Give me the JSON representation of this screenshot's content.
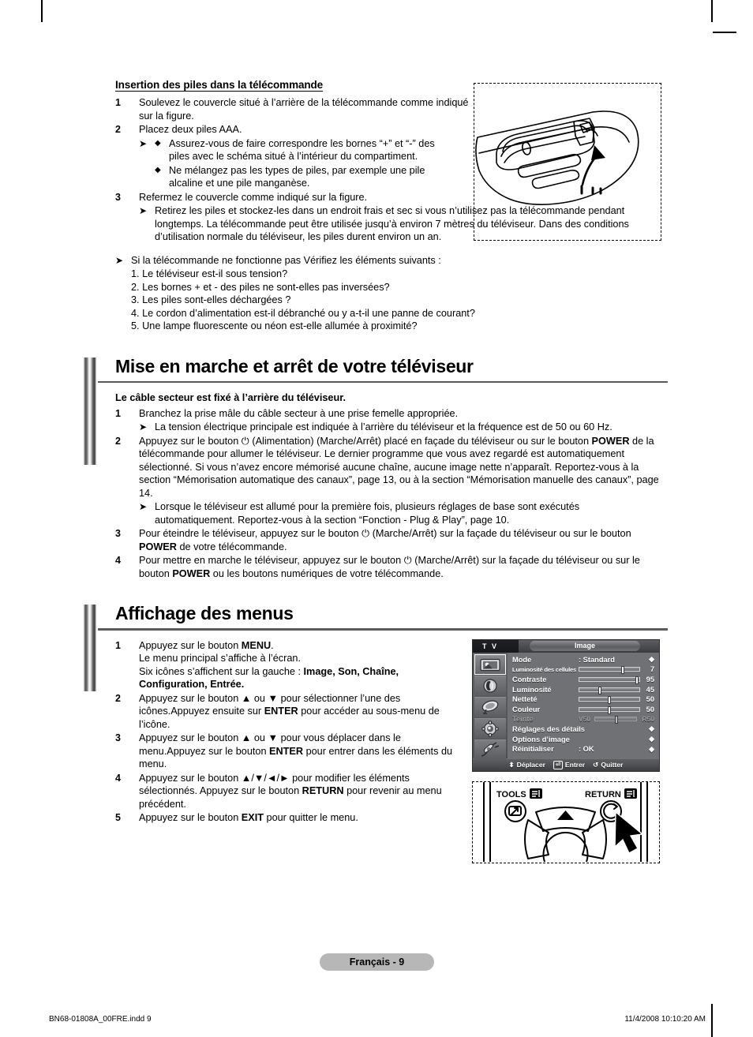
{
  "document": {
    "page_badge": "Français - 9",
    "footer_left": "BN68-01808A_00FRE.indd   9",
    "footer_right": "11/4/2008   10:10:20 AM"
  },
  "battery_section": {
    "heading": "Insertion des piles dans la télécommande",
    "steps": [
      {
        "num": "1",
        "text": "Soulevez le couvercle situé à l’arrière de la télécommande comme indiqué sur la figure."
      },
      {
        "num": "2",
        "text": "Placez deux piles AAA."
      },
      {
        "num": "3",
        "text": "Refermez le couvercle comme indiqué sur la figure."
      }
    ],
    "bullets": [
      "Assurez-vous de faire correspondre les bornes “+” et “-” des piles avec le schéma situé à l’intérieur du compartiment.",
      "Ne mélangez pas les types de piles, par exemple une pile alcaline et une pile manganèse."
    ],
    "note_step3": "Retirez les piles et stockez-les dans un endroit frais et sec si vous n’utilisez pas la télécommande pendant longtemps. La télécommande peut être utilisée jusqu’à environ 7 mètres du téléviseur. Dans des conditions d’utilisation normale du téléviseur, les piles durent environ un an.",
    "troubleshoot_intro": "Si la télécommande ne fonctionne pas Vérifiez les éléments suivants :",
    "troubleshoot": [
      "1. Le téléviseur est-il sous tension?",
      "2. Les bornes + et - des piles ne sont-elles pas inversées?",
      "3. Les piles sont-elles déchargées ?",
      "4. Le cordon d’alimentation est-il débranché ou y a-t-il une panne de courant?",
      "5. Une lampe fluorescente ou néon est-elle allumée à proximité?"
    ]
  },
  "power_section": {
    "title": "Mise en marche et arrêt de votre téléviseur",
    "lead": "Le câble secteur est fixé à l’arrière du téléviseur.",
    "step1_num": "1",
    "step1": "Branchez la prise mâle du câble secteur à une prise femelle appropriée.",
    "step1_note": "La tension électrique principale est indiquée à l’arrière du téléviseur et la fréquence est de 50 ou 60 Hz.",
    "step2_num": "2",
    "step2_a": "Appuyez sur le bouton ",
    "step2_icon": "power-symbol",
    "step2_b": " (Alimentation) (Marche/Arrêt) placé en façade du téléviseur ou sur le bouton ",
    "step2_bold1": "POWER",
    "step2_c": " de la télécommande pour allumer le téléviseur. Le dernier programme que vous avez regardé est automatiquement sélectionné. Si vous n’avez encore mémorisé aucune chaîne, aucune image nette n’apparaît. Reportez-vous à la section “Mémorisation automatique des canaux”, page 13, ou à la section “Mémorisation manuelle des canaux”, page 14.",
    "step2_note": "Lorsque le téléviseur est allumé pour la première fois, plusieurs réglages de base sont exécutés automatiquement. Reportez-vous à la section “Fonction - Plug & Play”, page 10.",
    "step3_num": "3",
    "step3_a": "Pour éteindre le téléviseur, appuyez sur le bouton ",
    "step3_b": " (Marche/Arrêt) sur la façade du téléviseur ou sur le bouton ",
    "step3_bold": "POWER",
    "step3_c": " de votre télécommande.",
    "step4_num": "4",
    "step4_a": "Pour mettre en marche le téléviseur, appuyez sur le bouton ",
    "step4_b": " (Marche/Arrêt) sur la façade du téléviseur ou sur le bouton ",
    "step4_bold": "POWER",
    "step4_c": " ou les boutons numériques de votre télécommande."
  },
  "menu_section": {
    "title": "Affichage des menus",
    "step1_num": "1",
    "step1_a": "Appuyez sur le bouton ",
    "step1_bold": "MENU",
    "step1_b": ".",
    "step1_line2": "Le menu principal s’affiche à l’écran.",
    "step1_line3_a": "Six icônes s’affichent sur la gauche : ",
    "step1_line3_bold": "Image, Son, Chaîne, Configuration, Entrée.",
    "step2_num": "2",
    "step2_a": "Appuyez sur le bouton ▲ ou ▼ pour sélectionner l’une des icônes.Appuyez ensuite sur ",
    "step2_bold": "ENTER",
    "step2_b": " pour accéder au sous-menu de l’icône.",
    "step3_num": "3",
    "step3_a": "Appuyez sur le bouton ▲ ou ▼ pour vous déplacer dans le menu.Appuyez sur le bouton ",
    "step3_bold": "ENTER",
    "step3_b": " pour entrer dans les éléments du menu.",
    "step4_num": "4",
    "step4_a": "Appuyez sur le bouton ▲/▼/◄/► pour modifier les éléments sélectionnés. Appuyez sur le bouton ",
    "step4_bold": "RETURN",
    "step4_b": " pour revenir au menu précédent.",
    "step5_num": "5",
    "step5_a": "Appuyez sur le bouton ",
    "step5_bold": "EXIT",
    "step5_b": " pour quitter le menu."
  },
  "osd": {
    "tv_label": "T V",
    "title": "Image",
    "sidebar_icons": [
      "picture-icon",
      "sound-icon",
      "channel-icon",
      "setup-icon",
      "input-icon"
    ],
    "rows": [
      {
        "label": "Mode",
        "type": "value",
        "value": ": Standard",
        "marker": "◆"
      },
      {
        "label": "Luminosité des cellules",
        "type": "slider",
        "value": "7",
        "pos": 70,
        "small": true
      },
      {
        "label": "Contraste",
        "type": "slider",
        "value": "95",
        "pos": 95
      },
      {
        "label": "Luminosité",
        "type": "slider",
        "value": "45",
        "pos": 32
      },
      {
        "label": "Netteté",
        "type": "slider",
        "value": "50",
        "pos": 50
      },
      {
        "label": "Couleur",
        "type": "slider",
        "value": "50",
        "pos": 50
      },
      {
        "label": "Teinte",
        "type": "tint",
        "pre": "V50",
        "post": "R50",
        "pos": 50,
        "dim": true
      },
      {
        "label": "Réglages des détails",
        "type": "value",
        "value": "",
        "marker": "◆"
      },
      {
        "label": "Options d’image",
        "type": "value",
        "value": "",
        "marker": "◆"
      },
      {
        "label": "Réinitialiser",
        "type": "value",
        "value": ": OK",
        "marker": "◆"
      }
    ],
    "footer": [
      {
        "icon": "updown-arrows",
        "glyph": "⬍",
        "label": "Déplacer"
      },
      {
        "icon": "enter-key",
        "glyph": "⏎",
        "label": "Entrer"
      },
      {
        "icon": "return-key",
        "glyph": "↺",
        "label": "Quitter"
      }
    ]
  },
  "remote_closeup": {
    "tools_label": "TOOLS",
    "return_label": "RETURN"
  },
  "colors": {
    "osd_bg": "#6f7174",
    "osd_dark": "#3a3c3f",
    "badge_gray": "#b7b7b7",
    "rule_gray": "#5b5b5b"
  }
}
